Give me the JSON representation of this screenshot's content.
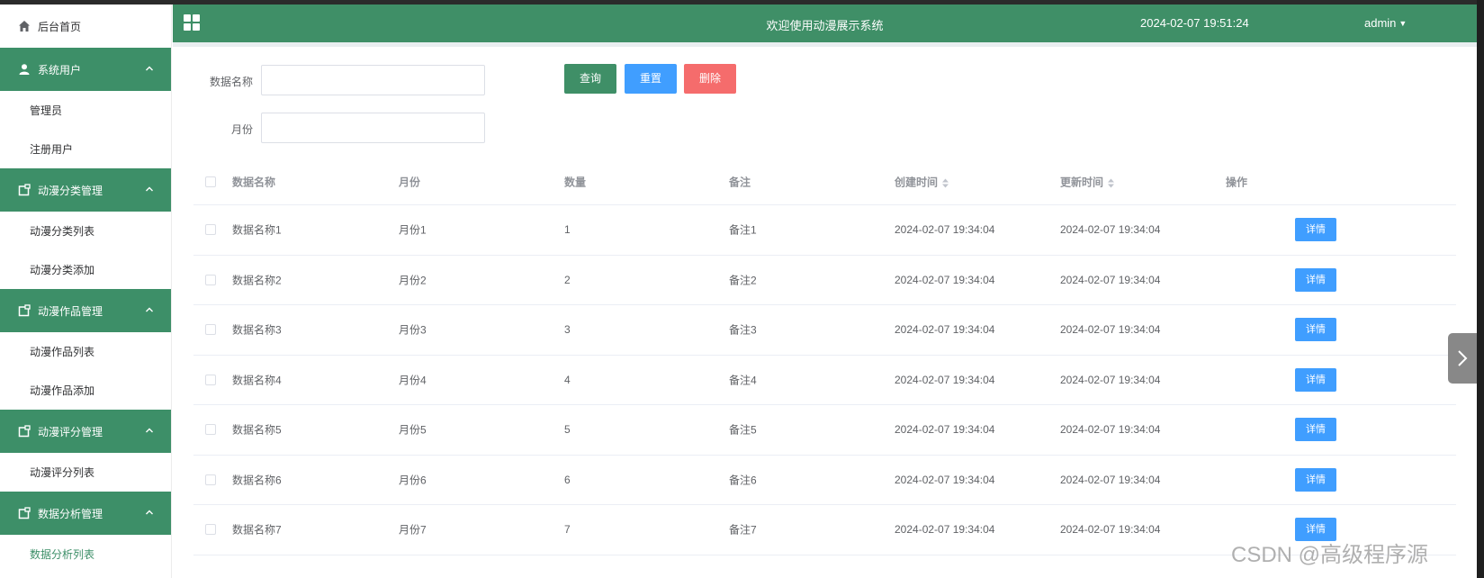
{
  "app": {
    "header_title": "欢迎使用动漫展示系统",
    "datetime": "2024-02-07 19:51:24",
    "user": "admin"
  },
  "sidebar": {
    "home": "后台首页",
    "groups": [
      {
        "label": "系统用户",
        "icon": "user-icon",
        "items": [
          "管理员",
          "注册用户"
        ]
      },
      {
        "label": "动漫分类管理",
        "icon": "folder-icon",
        "items": [
          "动漫分类列表",
          "动漫分类添加"
        ]
      },
      {
        "label": "动漫作品管理",
        "icon": "folder-icon",
        "items": [
          "动漫作品列表",
          "动漫作品添加"
        ]
      },
      {
        "label": "动漫评分管理",
        "icon": "folder-icon",
        "items": [
          "动漫评分列表"
        ]
      },
      {
        "label": "数据分析管理",
        "icon": "folder-icon",
        "items": [
          "数据分析列表"
        ]
      }
    ],
    "active_item": "数据分析列表"
  },
  "search": {
    "name_label": "数据名称",
    "name_value": "",
    "month_label": "月份",
    "month_value": "",
    "query": "查询",
    "reset": "重置",
    "delete": "删除"
  },
  "table": {
    "columns": [
      "数据名称",
      "月份",
      "数量",
      "备注",
      "创建时间",
      "更新时间",
      "操作"
    ],
    "detail_label": "详情",
    "rows": [
      [
        "数据名称1",
        "月份1",
        "1",
        "备注1",
        "2024-02-07 19:34:04",
        "2024-02-07 19:34:04"
      ],
      [
        "数据名称2",
        "月份2",
        "2",
        "备注2",
        "2024-02-07 19:34:04",
        "2024-02-07 19:34:04"
      ],
      [
        "数据名称3",
        "月份3",
        "3",
        "备注3",
        "2024-02-07 19:34:04",
        "2024-02-07 19:34:04"
      ],
      [
        "数据名称4",
        "月份4",
        "4",
        "备注4",
        "2024-02-07 19:34:04",
        "2024-02-07 19:34:04"
      ],
      [
        "数据名称5",
        "月份5",
        "5",
        "备注5",
        "2024-02-07 19:34:04",
        "2024-02-07 19:34:04"
      ],
      [
        "数据名称6",
        "月份6",
        "6",
        "备注6",
        "2024-02-07 19:34:04",
        "2024-02-07 19:34:04"
      ],
      [
        "数据名称7",
        "月份7",
        "7",
        "备注7",
        "2024-02-07 19:34:04",
        "2024-02-07 19:34:04"
      ]
    ]
  },
  "watermark": "CSDN @高级程序源",
  "colors": {
    "primary_green": "#3f8f67",
    "blue": "#409eff",
    "red": "#f56c6c"
  }
}
